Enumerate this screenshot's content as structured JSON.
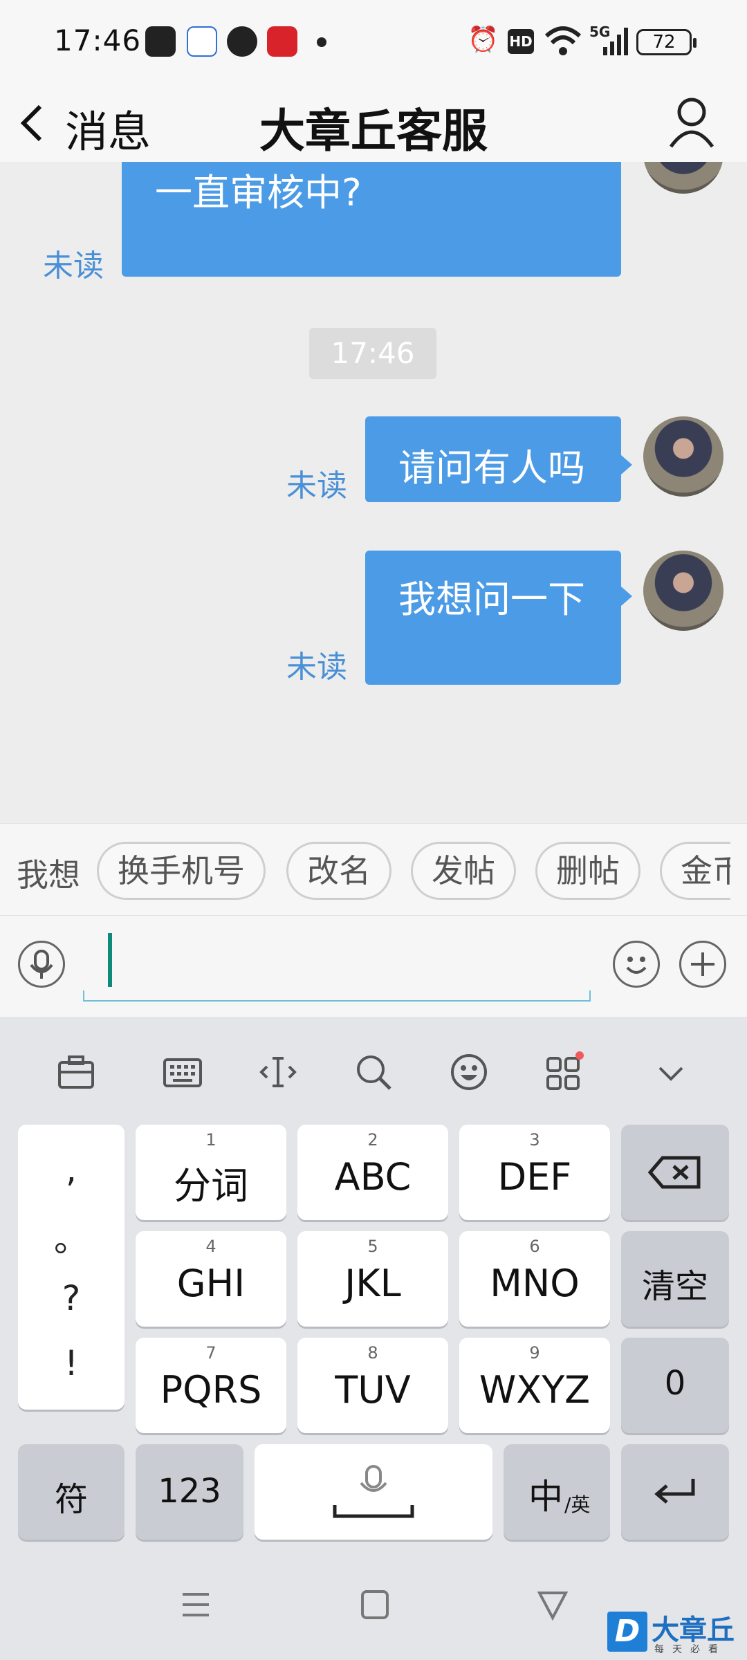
{
  "status_bar": {
    "time": "17:46",
    "battery": "72",
    "hd_label": "HD",
    "network_label": "5G"
  },
  "title_bar": {
    "back_label": "消息",
    "title": "大章丘客服"
  },
  "chat": {
    "messages": [
      {
        "text": "一直审核中?",
        "status": "未读"
      },
      {
        "text": "请问有人吗",
        "status": "未读"
      },
      {
        "text": "我想问一下",
        "status": "未读"
      }
    ],
    "timestamp": "17:46"
  },
  "quick_replies": {
    "label": "我想",
    "chips": [
      "换手机号",
      "改名",
      "发帖",
      "删帖",
      "金币"
    ]
  },
  "keyboard": {
    "toolbar_icons": [
      "toolbox-icon",
      "keyboard-icon",
      "cursor-move-icon",
      "search-icon",
      "emoji-icon",
      "apps-icon",
      "collapse-icon"
    ],
    "punctuation": [
      ",",
      "。",
      "?",
      "!"
    ],
    "keys": [
      {
        "num": "1",
        "label": "分词"
      },
      {
        "num": "2",
        "label": "ABC"
      },
      {
        "num": "3",
        "label": "DEF"
      },
      {
        "num": "4",
        "label": "GHI"
      },
      {
        "num": "5",
        "label": "JKL"
      },
      {
        "num": "6",
        "label": "MNO"
      },
      {
        "num": "7",
        "label": "PQRS"
      },
      {
        "num": "8",
        "label": "TUV"
      },
      {
        "num": "9",
        "label": "WXYZ"
      }
    ],
    "clear_label": "清空",
    "zero_label": "0",
    "symbol_label": "符",
    "numeric_label": "123",
    "lang_main": "中",
    "lang_sub": "/英"
  },
  "watermark": {
    "logo_letter": "D",
    "text": "大章丘",
    "sub": "每天必看"
  },
  "colors": {
    "bubble": "#4c9be6",
    "unread": "#4a90d6",
    "cursor": "#0e8a78"
  }
}
